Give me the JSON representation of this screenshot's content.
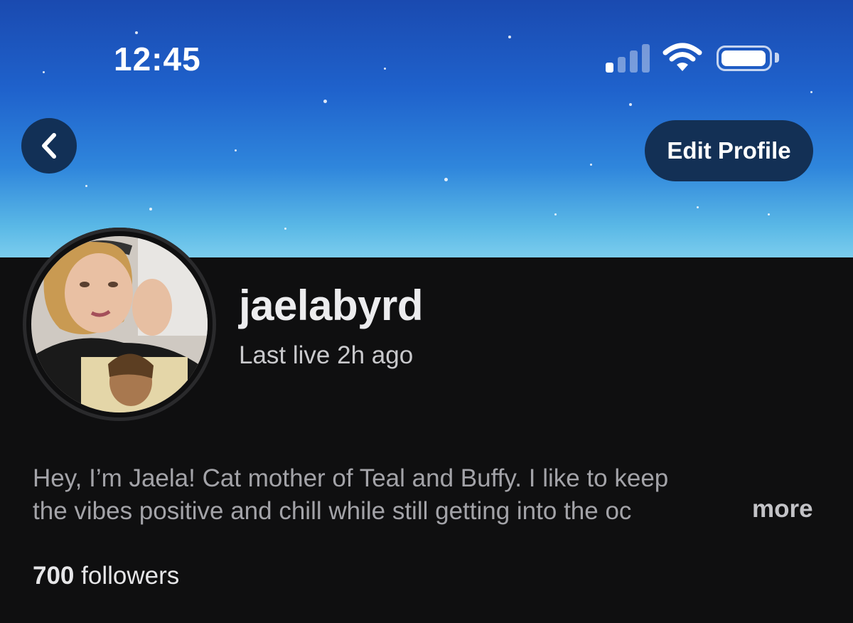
{
  "status_bar": {
    "time": "12:45",
    "icons": [
      "cellular-signal-icon",
      "wifi-icon",
      "battery-icon"
    ]
  },
  "header": {
    "back_icon": "chevron-left-icon",
    "edit_profile_label": "Edit Profile"
  },
  "profile": {
    "username": "jaelabyrd",
    "last_live": "Last live 2h ago",
    "bio_line1": "Hey, I’m Jaela!  Cat mother of Teal and Buffy.  I like to keep",
    "bio_line2": "the vibes positive and chill while still getting into the oc",
    "more_label": "more",
    "followers_count": "700",
    "followers_label": "followers"
  },
  "colors": {
    "background": "#0f0f10",
    "banner_top": "#1a4ab0",
    "banner_bottom": "#7bcdee",
    "button_bg": "#133055"
  }
}
